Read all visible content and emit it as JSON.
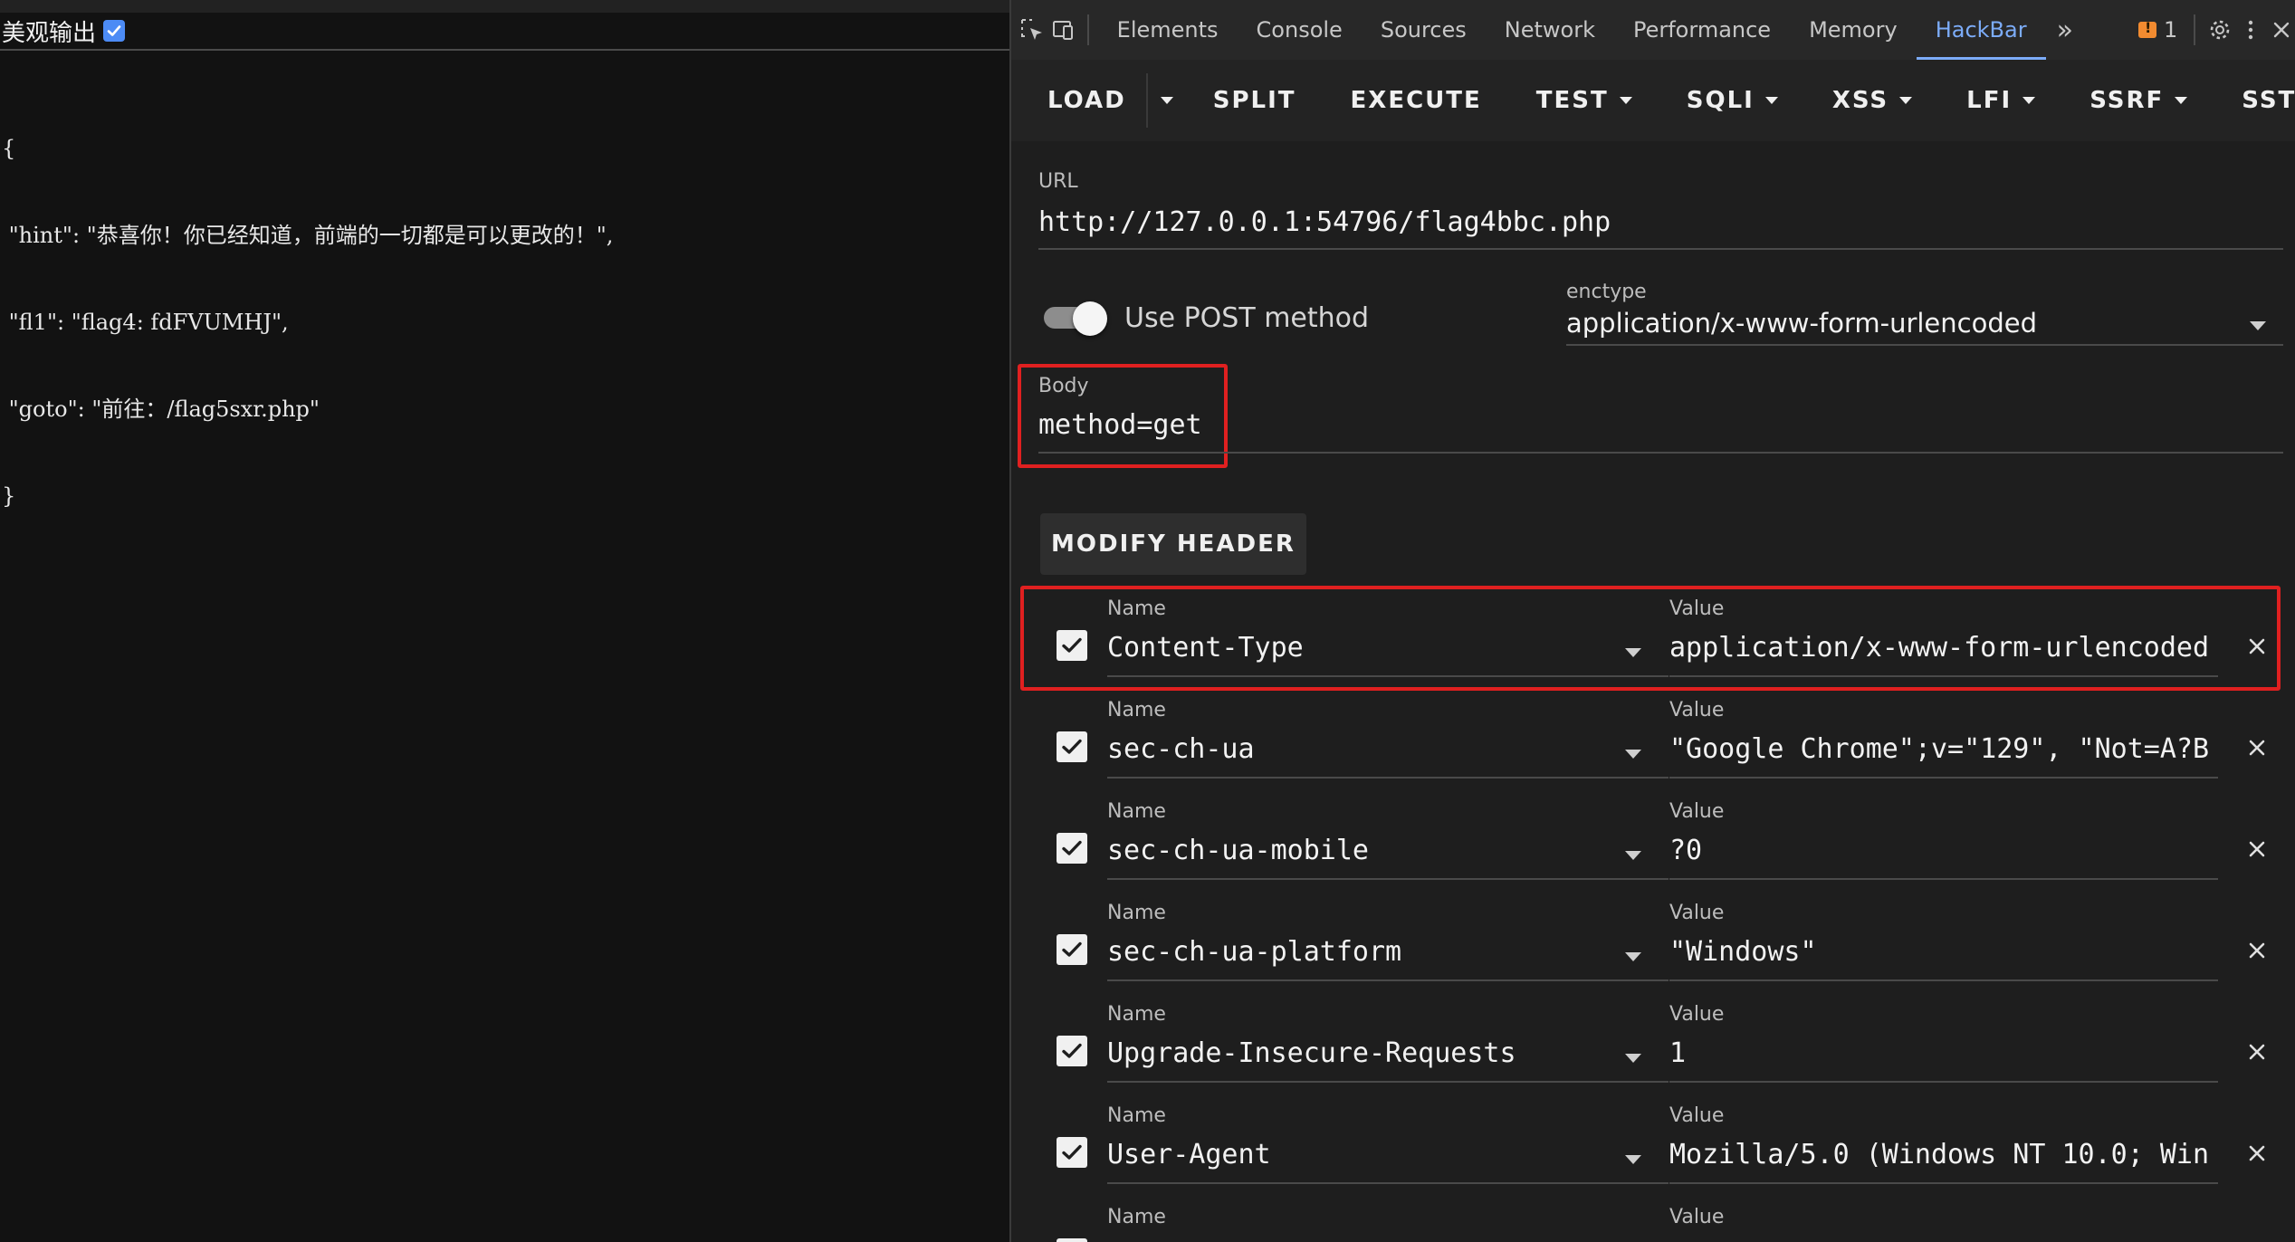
{
  "page": {
    "pretty_print_label": "美观输出",
    "pretty_print_checked": true,
    "json_lines": [
      "{",
      " \"hint\": \"恭喜你！你已经知道，前端的一切都是可以更改的！\",",
      " \"fl1\": \"flag4: fdFVUMHJ\",",
      " \"goto\": \"前往：/flag5sxr.php\"",
      "}"
    ]
  },
  "devtools": {
    "tabs": [
      "Elements",
      "Console",
      "Sources",
      "Network",
      "Performance",
      "Memory",
      "HackBar"
    ],
    "active_tab": "HackBar",
    "more_label": "»",
    "issues_count": "1",
    "icons": [
      "inspect-icon",
      "device-toggle-icon",
      "issues-flag-icon",
      "settings-gear-icon",
      "kebab-menu-icon",
      "close-icon"
    ]
  },
  "hackbar": {
    "toolbar": {
      "load": "LOAD",
      "split": "SPLIT",
      "execute": "EXECUTE",
      "test": "TEST",
      "sqli": "SQLI",
      "xss": "XSS",
      "lfi": "LFI",
      "ssrf": "SSRF",
      "ssti": "SSTI"
    },
    "url_label": "URL",
    "url_value": "http://127.0.0.1:54796/flag4bbc.php",
    "post_label": "Use POST method",
    "post_enabled": true,
    "enctype_label": "enctype",
    "enctype_value": "application/x-www-form-urlencoded",
    "body_label": "Body",
    "body_value": "method=get",
    "modify_header_label": "MODIFY HEADER",
    "headers": [
      {
        "name_label": "Name",
        "value_label": "Value",
        "name": "Content-Type",
        "value": "application/x-www-form-urlencoded",
        "checked": true
      },
      {
        "name_label": "Name",
        "value_label": "Value",
        "name": "sec-ch-ua",
        "value": "\"Google Chrome\";v=\"129\", \"Not=A?B",
        "checked": true
      },
      {
        "name_label": "Name",
        "value_label": "Value",
        "name": "sec-ch-ua-mobile",
        "value": "?0",
        "checked": true
      },
      {
        "name_label": "Name",
        "value_label": "Value",
        "name": "sec-ch-ua-platform",
        "value": "\"Windows\"",
        "checked": true
      },
      {
        "name_label": "Name",
        "value_label": "Value",
        "name": "Upgrade-Insecure-Requests",
        "value": "1",
        "checked": true
      },
      {
        "name_label": "Name",
        "value_label": "Value",
        "name": "User-Agent",
        "value": "Mozilla/5.0 (Windows NT 10.0; Win",
        "checked": true
      },
      {
        "name_label": "Name",
        "value_label": "Value",
        "name": "",
        "value": "",
        "checked": true
      }
    ]
  },
  "colors": {
    "accent_tab": "#7cacf8",
    "highlight_box": "#e02020",
    "checkbox_blue": "#4c8bf5"
  }
}
